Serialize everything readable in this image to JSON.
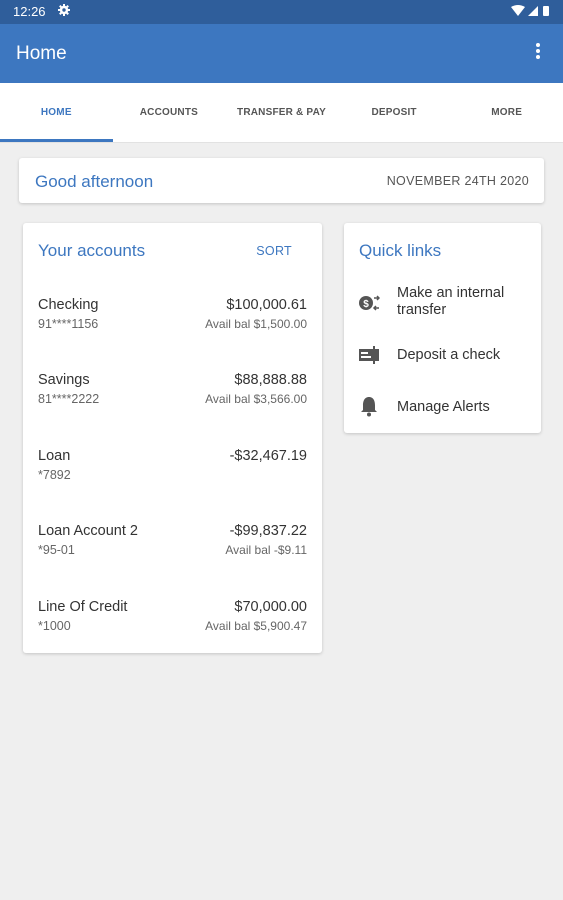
{
  "status_bar": {
    "time": "12:26"
  },
  "app_bar": {
    "title": "Home"
  },
  "tabs": [
    {
      "label": "HOME",
      "active": true
    },
    {
      "label": "ACCOUNTS",
      "active": false
    },
    {
      "label": "TRANSFER & PAY",
      "active": false
    },
    {
      "label": "DEPOSIT",
      "active": false
    },
    {
      "label": "MORE",
      "active": false
    }
  ],
  "greeting": {
    "title": "Good afternoon",
    "date": "NOVEMBER 24TH 2020"
  },
  "accounts": {
    "title": "Your accounts",
    "sort_label": "SORT",
    "items": [
      {
        "name": "Checking",
        "number": "91****1156",
        "amount": "$100,000.61",
        "avail": "Avail bal $1,500.00"
      },
      {
        "name": "Savings",
        "number": "81****2222",
        "amount": "$88,888.88",
        "avail": "Avail bal $3,566.00"
      },
      {
        "name": "Loan",
        "number": "*7892",
        "amount": "-$32,467.19",
        "avail": ""
      },
      {
        "name": "Loan Account 2",
        "number": "*95-01",
        "amount": "-$99,837.22",
        "avail": "Avail bal -$9.11"
      },
      {
        "name": "Line Of Credit",
        "number": "*1000",
        "amount": "$70,000.00",
        "avail": "Avail bal $5,900.47"
      }
    ]
  },
  "quick_links": {
    "title": "Quick links",
    "items": [
      {
        "label": "Make an internal transfer",
        "icon": "transfer-icon"
      },
      {
        "label": "Deposit a check",
        "icon": "check-icon"
      },
      {
        "label": "Manage Alerts",
        "icon": "bell-icon"
      }
    ]
  },
  "colors": {
    "primary": "#3d77c0",
    "status_bar": "#2f5e9b",
    "background": "#efefef"
  }
}
